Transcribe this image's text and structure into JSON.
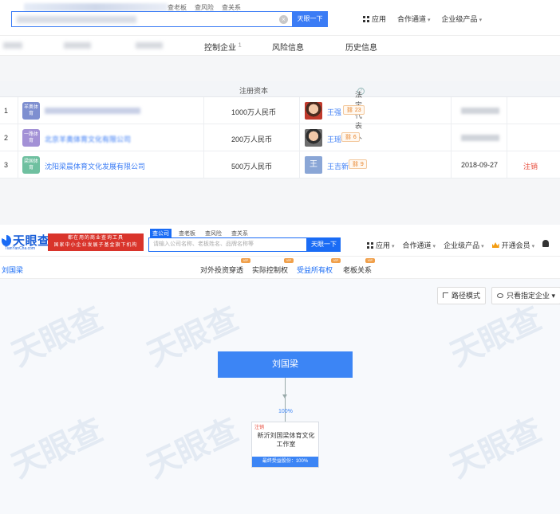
{
  "top": {
    "mini_tabs": [
      "查老板",
      "查风险",
      "查关系"
    ],
    "search_button": "天眼一下",
    "nav": [
      "应用",
      "合作通道",
      "企业级产品"
    ],
    "subtabs": [
      {
        "label": "控制企业",
        "count": "1"
      },
      {
        "label": "风险信息",
        "count": ""
      },
      {
        "label": "历史信息",
        "count": ""
      }
    ],
    "table": {
      "headers": {
        "capital": "注册资本",
        "rep": "法定代表人"
      },
      "rows": [
        {
          "num": "1",
          "logo": "羊奥体育",
          "logo_color": "#7e8fd0",
          "name": "",
          "capital": "1000万人民币",
          "rep": "王强",
          "badge": "23",
          "avatar": "photo",
          "date": "",
          "status": ""
        },
        {
          "num": "2",
          "logo": "一路体育",
          "logo_color": "#a391d6",
          "name": "北京羊奥体育文化有限公司",
          "capital": "200万人民币",
          "rep": "王瑶",
          "badge": "6",
          "avatar": "photo",
          "date": "",
          "status": ""
        },
        {
          "num": "3",
          "logo": "梁国体育",
          "logo_color": "#6fc0a0",
          "name": "沈阳梁晨体育文化发展有限公司",
          "capital": "500万人民币",
          "rep": "王吉新",
          "badge": "9",
          "avatar": "王",
          "date": "2018-09-27",
          "status": "注销"
        }
      ]
    }
  },
  "bottom": {
    "brand": "天眼查",
    "brand_sub": "TianYanCha.com",
    "promo_line1": "都在用的商业查询工具",
    "promo_line2": "国家中小企业发展子基金旗下机构",
    "mini_tabs": [
      "查公司",
      "查老板",
      "查风险",
      "查关系"
    ],
    "search_placeholder": "请输入公司名称、老板姓名、品牌名称等",
    "search_button": "天眼一下",
    "nav": {
      "apps": "应用",
      "coop": "合作通道",
      "enterprise": "企业级产品",
      "vip": "开通会员"
    },
    "left_label": "刘国梁",
    "subtabs": [
      "对外投资穿透",
      "实际控制权",
      "受益所有权",
      "老板关系"
    ],
    "vip_tag": "VIP",
    "tools": {
      "route": "路径模式",
      "filter": "只看指定企业"
    },
    "watermark": "天眼查",
    "graph": {
      "person": "刘国梁",
      "percent": "100%",
      "company_tag": "注销",
      "company": "新沂刘国梁体育文化工作室",
      "beneficial": "最终受益股份：100%"
    }
  }
}
